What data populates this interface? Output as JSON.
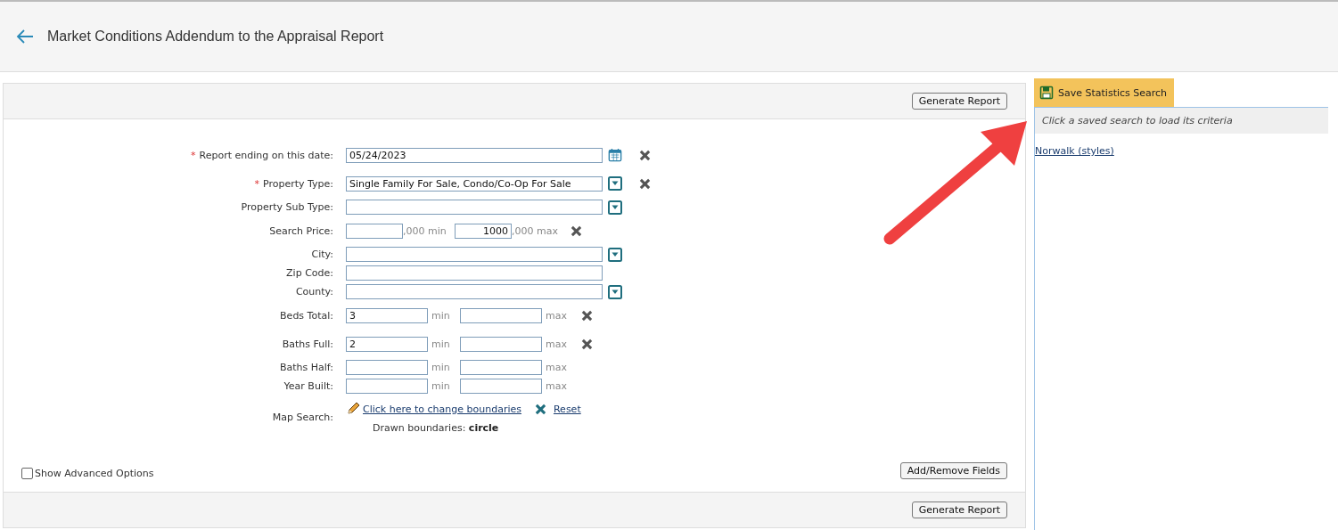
{
  "header": {
    "title": "Market Conditions Addendum to the Appraisal Report"
  },
  "form": {
    "top_button": "Generate Report",
    "rows": [
      {
        "kind": "single",
        "label": "Report ending on this date:",
        "required_mark": "*",
        "value": "05/24/2023",
        "calendar": true,
        "dropdown": false,
        "clearable": true
      },
      {
        "kind": "single",
        "label": "Property Type:",
        "required_mark": "*",
        "value": "Single Family For Sale, Condo/Co-Op For Sale",
        "calendar": false,
        "dropdown": true,
        "clearable": true
      },
      {
        "kind": "single",
        "label": "Property Sub Type:",
        "value": "",
        "calendar": false,
        "dropdown": true,
        "clearable": false
      },
      {
        "kind": "price_range",
        "label": "Search Price:",
        "min_value": "",
        "max_value": "1000",
        "min_suffix": ",000 min",
        "max_suffix": ",000 max",
        "clearable": true
      },
      {
        "kind": "single",
        "label": "City:",
        "value": "",
        "calendar": false,
        "dropdown": true,
        "clearable": false
      },
      {
        "kind": "single",
        "label": "Zip Code:",
        "value": "",
        "calendar": false,
        "dropdown": false,
        "clearable": false
      },
      {
        "kind": "single",
        "label": "County:",
        "value": "",
        "calendar": false,
        "dropdown": true,
        "clearable": false
      },
      {
        "kind": "range",
        "label": "Beds Total:",
        "min_value": "3",
        "max_value": "",
        "min_suffix": "min",
        "max_suffix": "max",
        "clearable": true
      },
      {
        "kind": "range",
        "label": "Baths Full:",
        "min_value": "2",
        "max_value": "",
        "min_suffix": "min",
        "max_suffix": "max",
        "clearable": true
      },
      {
        "kind": "range",
        "label": "Baths Half:",
        "min_value": "",
        "max_value": "",
        "min_suffix": "min",
        "max_suffix": "max",
        "clearable": false
      },
      {
        "kind": "range",
        "label": "Year Built:",
        "min_value": "",
        "max_value": "",
        "min_suffix": "min",
        "max_suffix": "max",
        "clearable": false
      }
    ],
    "map_search": {
      "label": "Map Search:",
      "change_link": "Click here to change boundaries",
      "reset_link": "Reset",
      "drawn_label": "Drawn boundaries:",
      "drawn_value": "circle"
    },
    "advanced": {
      "label": "Show Advanced Options",
      "checked": false
    },
    "add_remove_button": "Add/Remove Fields",
    "bottom_button": "Generate Report"
  },
  "sidebar": {
    "save_button": "Save Statistics Search",
    "hint": "Click a saved search to load its criteria",
    "saved_searches": [
      "Norwalk (styles)"
    ]
  }
}
